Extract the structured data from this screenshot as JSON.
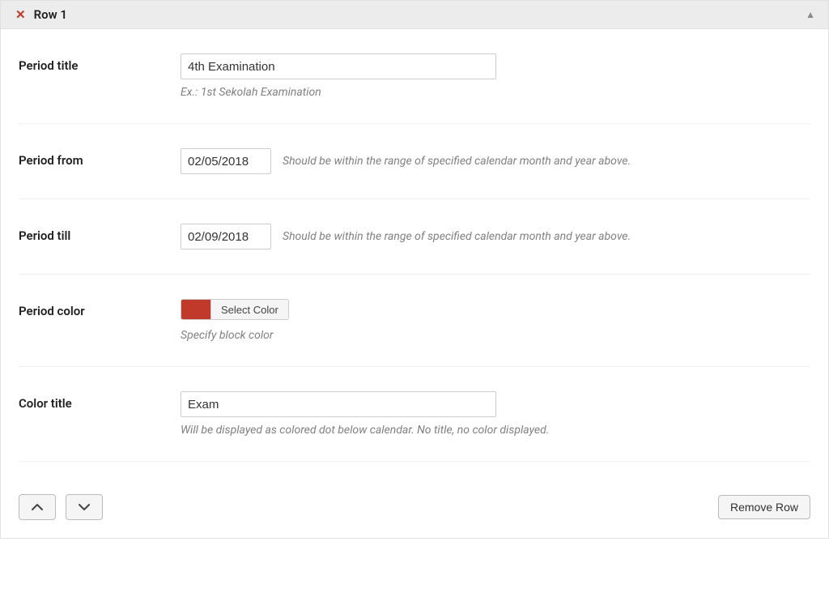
{
  "header": {
    "title": "Row 1"
  },
  "fields": {
    "period_title": {
      "label": "Period title",
      "value": "4th Examination",
      "help": "Ex.: 1st Sekolah Examination"
    },
    "period_from": {
      "label": "Period from",
      "value": "02/05/2018",
      "help": "Should be within the range of specified calendar month and year above."
    },
    "period_till": {
      "label": "Period till",
      "value": "02/09/2018",
      "help": "Should be within the range of specified calendar month and year above."
    },
    "period_color": {
      "label": "Period color",
      "swatch": "#c0392b",
      "button_label": "Select Color",
      "help": "Specify block color"
    },
    "color_title": {
      "label": "Color title",
      "value": "Exam",
      "help": "Will be displayed as colored dot below calendar. No title, no color displayed."
    }
  },
  "footer": {
    "remove_label": "Remove Row"
  }
}
